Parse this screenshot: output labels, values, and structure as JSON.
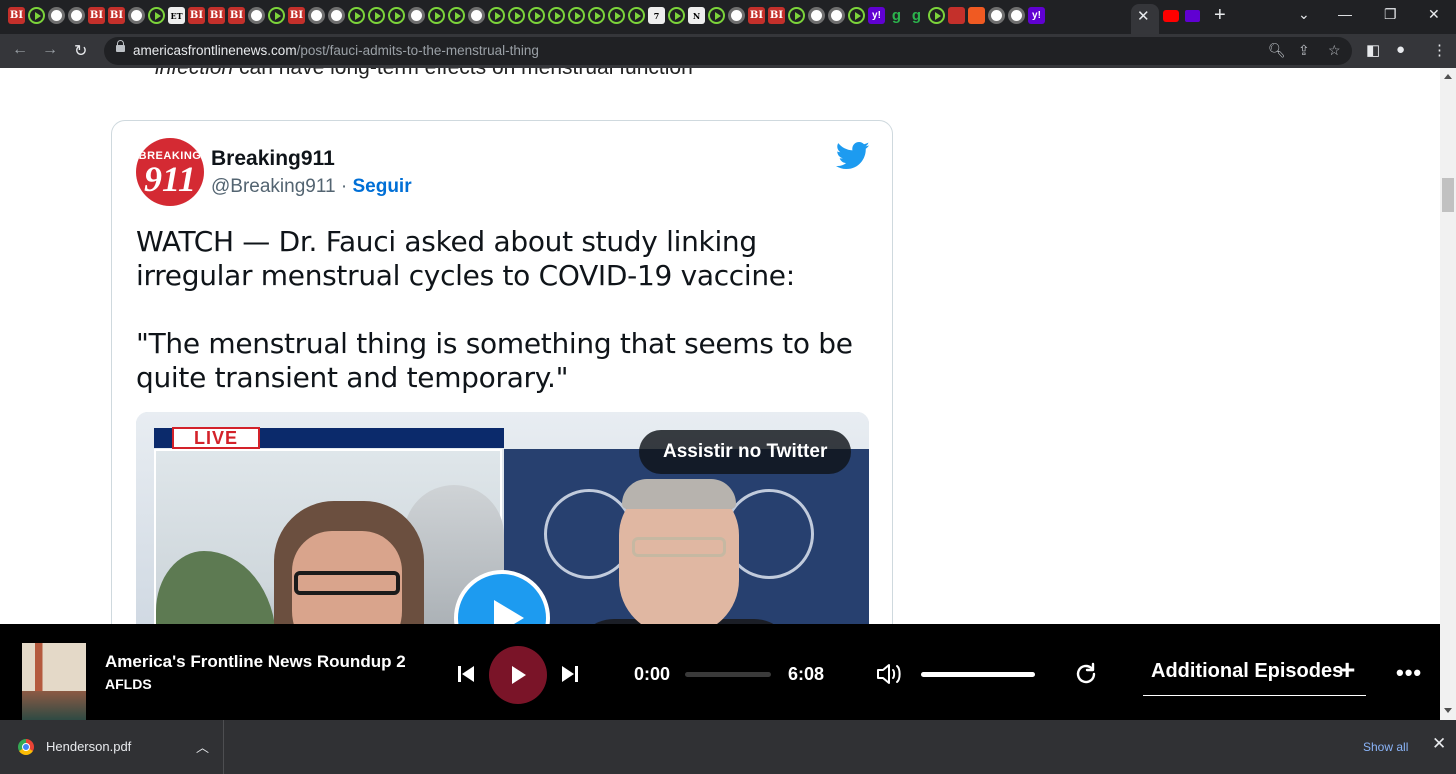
{
  "browser": {
    "url_host": "americasfrontlinenews.com",
    "url_path": "/post/fauci-admits-to-the-menstrual-thing",
    "active_tab_close": "✕",
    "new_tab": "+"
  },
  "article": {
    "prev_line_italic": "infection",
    "prev_line_rest": " can have long-term effects on menstrual function"
  },
  "tweet": {
    "avatar_text": "BREAKING",
    "avatar_number": "911",
    "author_name": "Breaking911",
    "author_handle": "@Breaking911",
    "separator": " · ",
    "follow_label": "Seguir",
    "text_para1": "WATCH — Dr. Fauci asked about study linking irregular menstrual cycles to COVID-19 vaccine:",
    "text_para2": "\"The menstrual thing is something that seems to be quite transient and temporary.\"",
    "live_badge": "LIVE",
    "watch_button": "Assistir no Twitter",
    "brand_color": "#1d9bf0"
  },
  "player": {
    "episode_title": "America's Frontline News Roundup 2...",
    "author": "AFLDS",
    "time_current": "0:00",
    "time_total": "6:08",
    "progress_fraction": 0,
    "volume_fraction": 1,
    "additional_label": "Additional Episodes",
    "additional_plus": "+",
    "more_label": "•••",
    "accent_color": "#7a1428"
  },
  "downloads": {
    "file_name": "Henderson.pdf",
    "show_all_label": "Show all",
    "close_label": "✕"
  }
}
